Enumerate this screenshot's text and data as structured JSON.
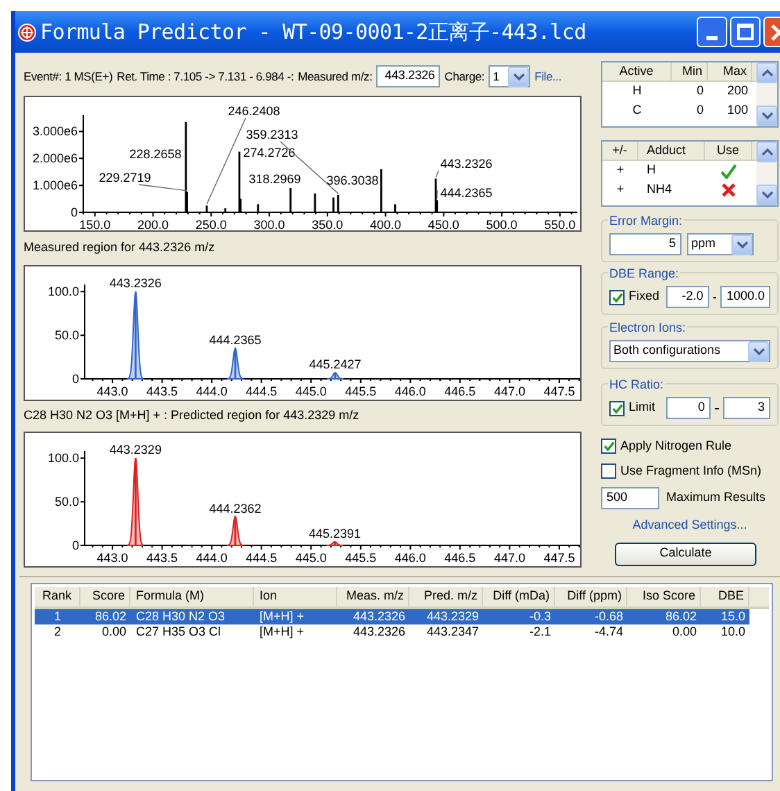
{
  "window": {
    "title": "Formula Predictor - WT-09-0001-2正离子-443.lcd"
  },
  "header": {
    "event": "Event#: 1 MS(E+)",
    "ret_time": "Ret. Time : 7.105 -> 7.131 - 6.984 -:",
    "measured_label": "Measured m/z:",
    "measured_value": "443.2326",
    "charge_label": "Charge:",
    "charge_value": "1",
    "file_link": "File..."
  },
  "spectrum": {
    "chart_data": {
      "type": "bar",
      "x": [
        228.2658,
        229.2719,
        246.2408,
        262.2,
        274.2726,
        275.3,
        290.3,
        318.2969,
        339.3,
        355.2,
        359.2313,
        396.3038,
        408.3,
        443.2326,
        444.2365
      ],
      "series": [
        {
          "color": "#000000",
          "values": [
            3350000,
            750000,
            250000,
            150000,
            2250000,
            500000,
            300000,
            900000,
            700000,
            550000,
            650000,
            1600000,
            300000,
            1250000,
            450000
          ]
        }
      ],
      "xlim": [
        140,
        565
      ],
      "ylim": [
        0,
        3500000
      ],
      "xticks": [
        {
          "value": 150,
          "label": "150.0"
        },
        {
          "value": 200,
          "label": "200.0"
        },
        {
          "value": 250,
          "label": "250.0"
        },
        {
          "value": 300,
          "label": "300.0"
        },
        {
          "value": 350,
          "label": "350.0"
        },
        {
          "value": 400,
          "label": "400.0"
        },
        {
          "value": 450,
          "label": "450.0"
        },
        {
          "value": 500,
          "label": "500.0"
        },
        {
          "value": 550,
          "label": "550.0"
        }
      ],
      "yticks": [
        {
          "value": 0,
          "label": "0"
        },
        {
          "value": 1000000,
          "label": "1.000e6"
        },
        {
          "value": 2000000,
          "label": "2.000e6"
        },
        {
          "value": 3000000,
          "label": "3.000e6"
        }
      ],
      "annotations": [
        "229.2719",
        "228.2658",
        "246.2408",
        "274.2726",
        "359.2313",
        "318.2969",
        "396.3038",
        "443.2326",
        "444.2365"
      ]
    }
  },
  "measured_region": {
    "title": "Measured region for 443.2326 m/z",
    "chart_data": {
      "type": "bar",
      "x": [
        443.2326,
        444.2365,
        445.2427
      ],
      "series": [
        {
          "color": "#3366cc",
          "values": [
            100,
            35,
            7
          ]
        }
      ],
      "xlim": [
        442.72,
        447.71
      ],
      "ylim": [
        0,
        105
      ],
      "xticks": [
        {
          "value": 443,
          "label": "443.0"
        },
        {
          "value": 443.5,
          "label": "443.5"
        },
        {
          "value": 444,
          "label": "444.0"
        },
        {
          "value": 444.5,
          "label": "444.5"
        },
        {
          "value": 445,
          "label": "445.0"
        },
        {
          "value": 445.5,
          "label": "445.5"
        },
        {
          "value": 446,
          "label": "446.0"
        },
        {
          "value": 446.5,
          "label": "446.5"
        },
        {
          "value": 447,
          "label": "447.0"
        },
        {
          "value": 447.5,
          "label": "447.5"
        }
      ],
      "yticks": [
        {
          "value": 0,
          "label": "0"
        },
        {
          "value": 50,
          "label": "50.0"
        },
        {
          "value": 100,
          "label": "100.0"
        }
      ],
      "annotations": [
        "443.2326",
        "444.2365",
        "445.2427"
      ]
    }
  },
  "predicted_region": {
    "title": "C28 H30 N2 O3 [M+H] + : Predicted region for 443.2329 m/z",
    "chart_data": {
      "type": "bar",
      "x": [
        443.2329,
        444.2362,
        445.2391
      ],
      "series": [
        {
          "color": "#e02020",
          "values": [
            100,
            33,
            4
          ]
        }
      ],
      "xlim": [
        442.72,
        447.71
      ],
      "ylim": [
        0,
        105
      ],
      "xticks": [
        {
          "value": 443,
          "label": "443.0"
        },
        {
          "value": 443.5,
          "label": "443.5"
        },
        {
          "value": 444,
          "label": "444.0"
        },
        {
          "value": 444.5,
          "label": "444.5"
        },
        {
          "value": 445,
          "label": "445.0"
        },
        {
          "value": 445.5,
          "label": "445.5"
        },
        {
          "value": 446,
          "label": "446.0"
        },
        {
          "value": 446.5,
          "label": "446.5"
        },
        {
          "value": 447,
          "label": "447.0"
        },
        {
          "value": 447.5,
          "label": "447.5"
        }
      ],
      "yticks": [
        {
          "value": 0,
          "label": "0"
        },
        {
          "value": 50,
          "label": "50.0"
        },
        {
          "value": 100,
          "label": "100.0"
        }
      ],
      "annotations": [
        "443.2329",
        "444.2362",
        "445.2391"
      ]
    }
  },
  "elements": {
    "columns": [
      "Active",
      "Min",
      "Max"
    ],
    "rows": [
      [
        "H",
        "0",
        "200"
      ],
      [
        "C",
        "0",
        "100"
      ]
    ]
  },
  "adducts": {
    "columns": [
      "+/-",
      "Adduct",
      "Use"
    ],
    "rows": [
      {
        "sign": "+",
        "name": "H",
        "use": true
      },
      {
        "sign": "+",
        "name": "NH4",
        "use": false
      }
    ]
  },
  "error_margin": {
    "label": "Error Margin:",
    "value": "5",
    "unit": "ppm"
  },
  "dbe_range": {
    "label": "DBE Range:",
    "fixed_label": "Fixed",
    "checked": true,
    "min": "-2.0",
    "max": "1000.0"
  },
  "electron_ions": {
    "label": "Electron Ions:",
    "value": "Both configurations"
  },
  "hc_ratio": {
    "label": "HC Ratio:",
    "limit_label": "Limit",
    "checked": true,
    "min": "0",
    "max": "3"
  },
  "options": [
    {
      "label": "Apply Nitrogen Rule",
      "checked": true
    },
    {
      "label": "Use Fragment Info (MSn)",
      "checked": false
    }
  ],
  "max_results": {
    "value": "500",
    "label": "Maximum Results"
  },
  "advanced_link": "Advanced Settings...",
  "calculate_button": "Calculate",
  "results": {
    "columns": [
      "Rank",
      "Score",
      "Formula (M)",
      "Ion",
      "Meas. m/z",
      "Pred. m/z",
      "Diff (mDa)",
      "Diff (ppm)",
      "Iso Score",
      "DBE"
    ],
    "rows": [
      {
        "selected": true,
        "cells": [
          "1",
          "86.02",
          "C28 H30 N2 O3",
          "[M+H] +",
          "443.2326",
          "443.2329",
          "-0.3",
          "-0.68",
          "86.02",
          "15.0"
        ]
      },
      {
        "selected": false,
        "cells": [
          "2",
          "0.00",
          "C27 H35 O3 Cl",
          "[M+H] +",
          "443.2326",
          "443.2347",
          "-2.1",
          "-4.74",
          "0.00",
          "10.0"
        ]
      }
    ]
  }
}
